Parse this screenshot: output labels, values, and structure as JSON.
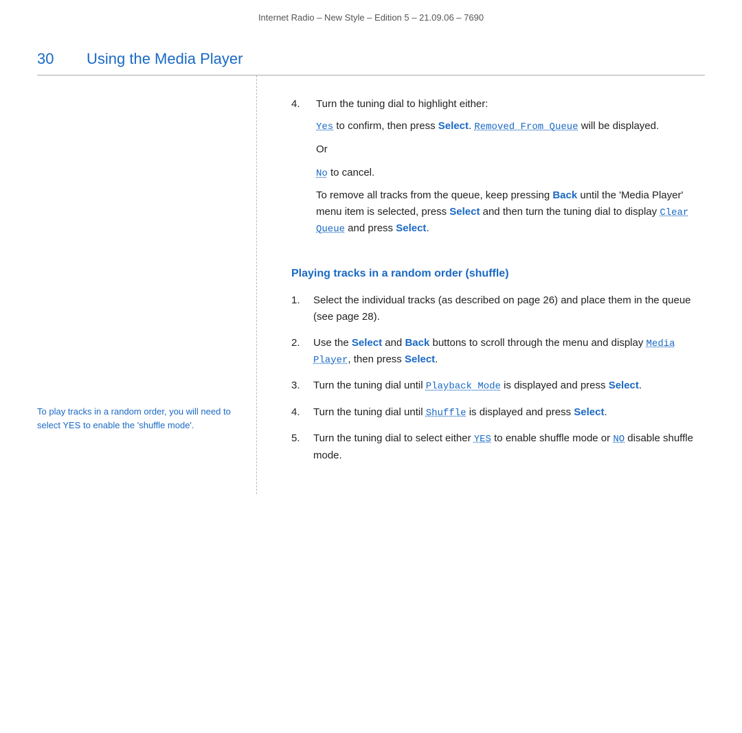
{
  "header": {
    "text": "Internet Radio – New Style – Edition 5 – 21.09.06 – 7690"
  },
  "chapter": {
    "number": "30",
    "title": "Using the Media Player"
  },
  "sidebar": {
    "note": "To play tracks in a random order, you will need to select YES to enable the 'shuffle mode'."
  },
  "step4_heading": "Turn the tuning dial to highlight either:",
  "step4_number": "4.",
  "yes_label": "Yes",
  "yes_suffix": " to confirm, then press ",
  "select1": "Select",
  "removed_label": "Removed From Queue",
  "removed_suffix": " will be displayed.",
  "or_text": "Or",
  "no_label": "No",
  "no_suffix": " to cancel.",
  "remove_all_text1": "To remove all tracks from the queue, keep pressing ",
  "back_label1": "Back",
  "remove_all_text2": " until the 'Media Player' menu item is selected, press ",
  "select2": "Select",
  "remove_all_text3": " and then turn the tuning dial to display ",
  "clear_queue_label": "Clear Queue",
  "remove_all_text4": " and press ",
  "select3": "Select",
  "remove_all_text5": ".",
  "section_heading": "Playing tracks in a random order (shuffle)",
  "steps": [
    {
      "num": "1.",
      "text_parts": [
        {
          "type": "text",
          "value": "Select the individual tracks (as described on page 26) and place them in the queue (see page 28)."
        }
      ]
    },
    {
      "num": "2.",
      "text_parts": [
        {
          "type": "text",
          "value": "Use the "
        },
        {
          "type": "bold-blue",
          "value": "Select"
        },
        {
          "type": "text",
          "value": " and "
        },
        {
          "type": "bold-blue",
          "value": "Back"
        },
        {
          "type": "text",
          "value": " buttons to scroll through the menu and display "
        },
        {
          "type": "mono-blue",
          "value": "Media Player"
        },
        {
          "type": "text",
          "value": ", then press "
        },
        {
          "type": "bold-blue",
          "value": "Select"
        },
        {
          "type": "text",
          "value": "."
        }
      ]
    },
    {
      "num": "3.",
      "text_parts": [
        {
          "type": "text",
          "value": "Turn the tuning dial until "
        },
        {
          "type": "mono-blue",
          "value": "Playback Mode"
        },
        {
          "type": "text",
          "value": " is displayed and press "
        },
        {
          "type": "bold-blue",
          "value": "Select"
        },
        {
          "type": "text",
          "value": "."
        }
      ]
    },
    {
      "num": "4.",
      "text_parts": [
        {
          "type": "text",
          "value": "Turn the tuning dial until "
        },
        {
          "type": "mono-blue",
          "value": "Shuffle"
        },
        {
          "type": "text",
          "value": " is displayed and press "
        },
        {
          "type": "bold-blue",
          "value": "Select"
        },
        {
          "type": "text",
          "value": "."
        }
      ]
    },
    {
      "num": "5.",
      "text_parts": [
        {
          "type": "text",
          "value": "Turn the tuning dial to select either "
        },
        {
          "type": "mono-blue",
          "value": "YES"
        },
        {
          "type": "text",
          "value": " to enable shuffle mode or "
        },
        {
          "type": "mono-blue",
          "value": "NO"
        },
        {
          "type": "text",
          "value": " disable shuffle mode."
        }
      ]
    }
  ]
}
